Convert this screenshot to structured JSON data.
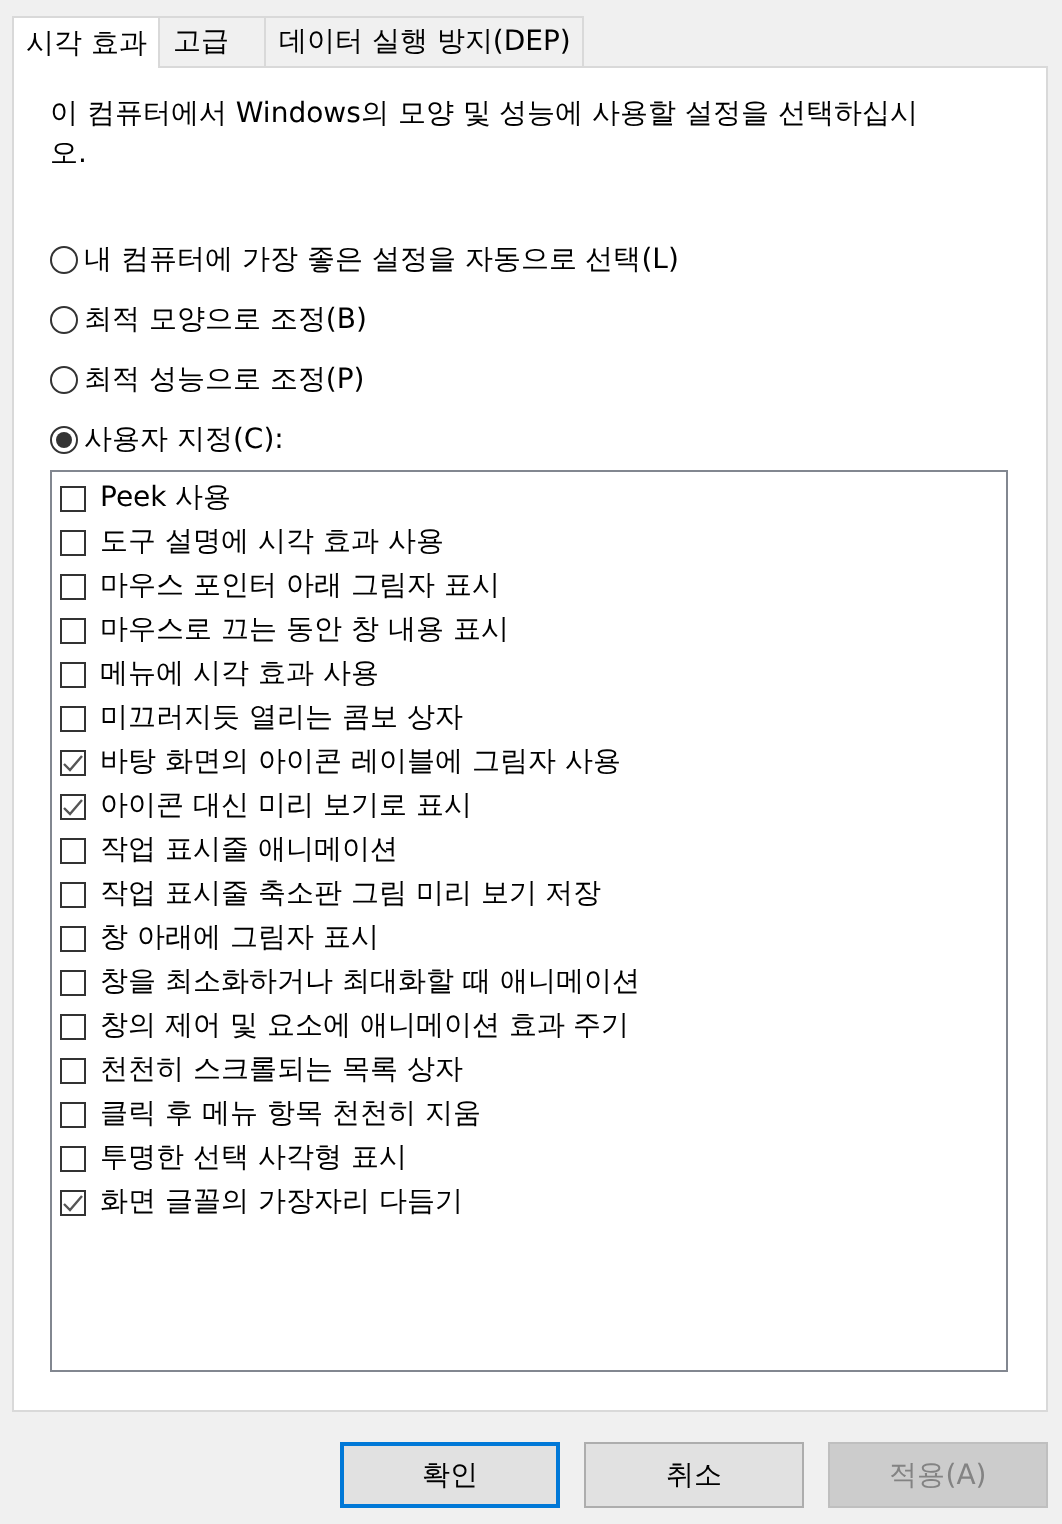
{
  "tabs": [
    {
      "label": "시각 효과",
      "selected": true
    },
    {
      "label": "고급",
      "selected": false
    },
    {
      "label": "데이터 실행 방지(DEP)",
      "selected": false
    }
  ],
  "description": "이 컴퓨터에서 Windows의 모양 및 성능에 사용할 설정을 선택하십시오.",
  "options": [
    {
      "label": "내 컴퓨터에 가장 좋은 설정을 자동으로 선택(L)",
      "selected": false
    },
    {
      "label": "최적 모양으로 조정(B)",
      "selected": false
    },
    {
      "label": "최적 성능으로 조정(P)",
      "selected": false
    },
    {
      "label": "사용자 지정(C):",
      "selected": true
    }
  ],
  "effects": [
    {
      "label": "Peek 사용",
      "checked": false
    },
    {
      "label": "도구 설명에 시각 효과 사용",
      "checked": false
    },
    {
      "label": "마우스 포인터 아래 그림자 표시",
      "checked": false
    },
    {
      "label": "마우스로 끄는 동안 창 내용 표시",
      "checked": false
    },
    {
      "label": "메뉴에 시각 효과 사용",
      "checked": false
    },
    {
      "label": "미끄러지듯 열리는 콤보 상자",
      "checked": false
    },
    {
      "label": "바탕 화면의 아이콘 레이블에 그림자 사용",
      "checked": true
    },
    {
      "label": "아이콘 대신 미리 보기로 표시",
      "checked": true
    },
    {
      "label": "작업 표시줄 애니메이션",
      "checked": false
    },
    {
      "label": "작업 표시줄 축소판 그림 미리 보기 저장",
      "checked": false
    },
    {
      "label": "창 아래에 그림자 표시",
      "checked": false
    },
    {
      "label": "창을 최소화하거나 최대화할 때 애니메이션",
      "checked": false
    },
    {
      "label": "창의 제어 및 요소에 애니메이션 효과 주기",
      "checked": false
    },
    {
      "label": "천천히 스크롤되는 목록 상자",
      "checked": false
    },
    {
      "label": "클릭 후 메뉴 항목 천천히 지움",
      "checked": false
    },
    {
      "label": "투명한 선택 사각형 표시",
      "checked": false
    },
    {
      "label": "화면 글꼴의 가장자리 다듬기",
      "checked": true
    }
  ],
  "buttons": [
    {
      "label": "확인",
      "default": true,
      "disabled": false
    },
    {
      "label": "취소",
      "default": false,
      "disabled": false
    },
    {
      "label": "적용(A)",
      "default": false,
      "disabled": true
    }
  ]
}
